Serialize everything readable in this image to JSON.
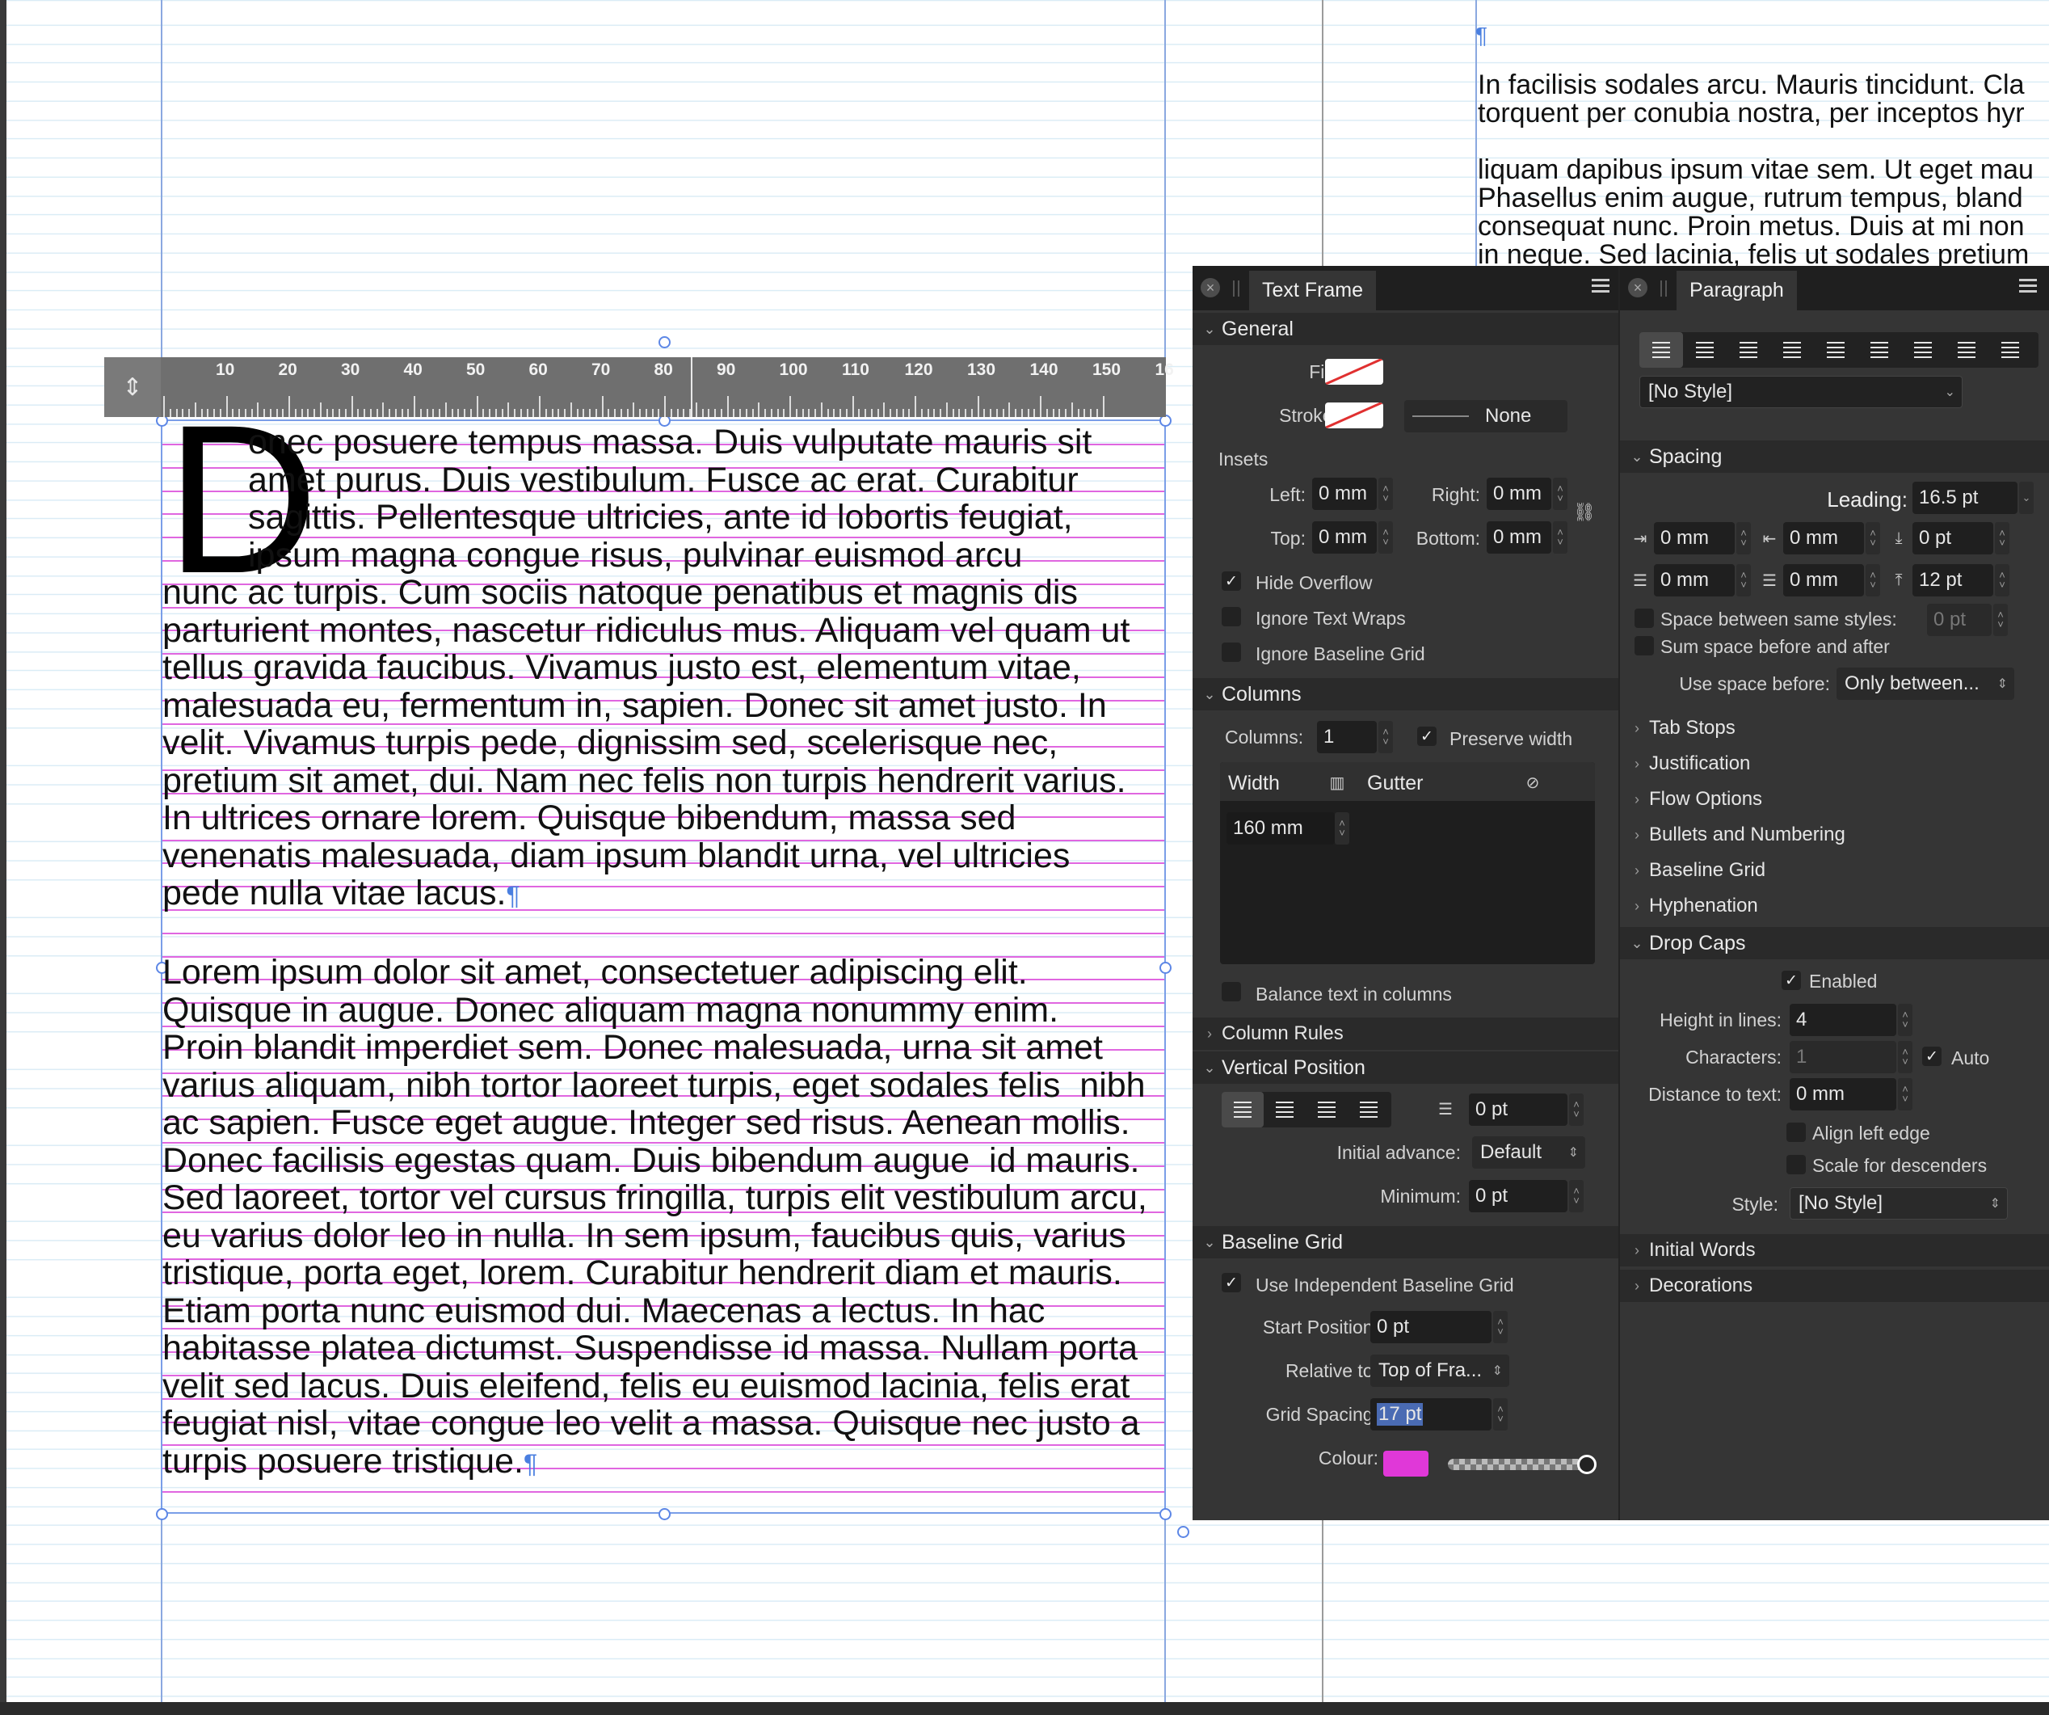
{
  "canvas": {
    "main_text": {
      "drop_cap": "D",
      "para1_lines": [
        "onec posuere tempus massa. Duis vulputate mauris sit",
        "amet purus. Duis vestibulum. Fusce ac erat. Curabitur",
        "sagittis. Pellentesque ultricies, ante id lobortis feugiat,",
        "ipsum magna congue risus, pulvinar euismod arcu",
        "nunc ac turpis. Cum sociis natoque penatibus et magnis dis",
        "parturient montes, nascetur ridiculus mus. Aliquam vel quam ut",
        "tellus gravida faucibus. Vivamus justo est, elementum vitae,",
        "malesuada eu, fermentum in, sapien. Donec sit amet justo. In",
        "velit. Vivamus turpis pede, dignissim sed, scelerisque nec,",
        "pretium sit amet, dui. Nam nec felis non turpis hendrerit varius.",
        "In ultrices ornare lorem. Quisque bibendum, massa sed",
        "venenatis malesuada, diam ipsum blandit urna, vel ultricies",
        "pede nulla vitae lacus."
      ],
      "para2_lines": [
        "Lorem ipsum dolor sit amet, consectetuer adipiscing elit.",
        "Quisque in augue. Donec aliquam magna nonummy enim.",
        "Proin blandit imperdiet sem. Donec malesuada, urna sit amet",
        "varius aliquam, nibh tortor laoreet turpis, eget sodales felis  nibh",
        "ac sapien. Fusce eget augue. Integer sed risus. Aenean mollis.",
        "Donec facilisis egestas quam. Duis bibendum augue  id mauris.",
        "Sed laoreet, tortor vel cursus fringilla, turpis elit vestibulum arcu,",
        "eu varius dolor leo in nulla. In sem ipsum, faucibus quis, varius",
        "tristique, porta eget, lorem. Curabitur hendrerit diam et mauris.",
        "Etiam porta nunc euismod dui. Maecenas a lectus. In hac",
        "habitasse platea dictumst. Suspendisse id massa. Nullam porta",
        "velit sed lacus. Duis eleifend, felis eu euismod lacinia, felis erat",
        "feugiat nisl, vitae congue leo velit a massa. Quisque nec justo a",
        "turpis posuere tristique."
      ],
      "pilcrow": "¶"
    },
    "right_text": "In facilisis sodales arcu. Mauris tincidunt. Cla\ntorquent per conubia nostra, per inceptos hyr\n\nliquam dapibus ipsum vitae sem. Ut eget mau\nPhasellus enim augue, rutrum tempus, bland\nconsequat nunc. Proin metus. Duis at mi non\nin neque. Sed lacinia, felis ut sodales pretium",
    "ruler": {
      "labels": [
        "10",
        "20",
        "30",
        "40",
        "50",
        "60",
        "70",
        "80",
        "90",
        "100",
        "110",
        "120",
        "130",
        "140",
        "150",
        "16"
      ],
      "handle_icon": "⇕"
    }
  },
  "text_frame_panel": {
    "title": "Text Frame",
    "close_icon": "×",
    "general": {
      "header": "General",
      "fill_label": "Fill:",
      "stroke_label": "Stroke:",
      "stroke_none": "None",
      "insets_label": "Insets",
      "left_label": "Left:",
      "left_value": "0 mm",
      "right_label": "Right:",
      "right_value": "0 mm",
      "top_label": "Top:",
      "top_value": "0 mm",
      "bottom_label": "Bottom:",
      "bottom_value": "0 mm",
      "hide_overflow": "Hide Overflow",
      "ignore_text_wraps": "Ignore Text Wraps",
      "ignore_baseline_grid": "Ignore Baseline Grid"
    },
    "columns": {
      "header": "Columns",
      "columns_label": "Columns:",
      "columns_value": "1",
      "preserve_width": "Preserve width",
      "width_header": "Width",
      "gutter_header": "Gutter",
      "width_value": "160 mm",
      "balance": "Balance text in columns"
    },
    "column_rules": "Column Rules",
    "vertical_position": {
      "header": "Vertical Position",
      "offset_value": "0 pt",
      "initial_advance_label": "Initial advance:",
      "initial_advance_value": "Default",
      "minimum_label": "Minimum:",
      "minimum_value": "0 pt"
    },
    "baseline_grid": {
      "header": "Baseline Grid",
      "use_independent": "Use Independent Baseline Grid",
      "start_label": "Start Position:",
      "start_value": "0 pt",
      "relative_label": "Relative to:",
      "relative_value": "Top of Fra...",
      "spacing_label": "Grid Spacing:",
      "spacing_value": "17 pt",
      "colour_label": "Colour:",
      "colour_hex": "#e038d8"
    }
  },
  "paragraph_panel": {
    "title": "Paragraph",
    "style_value": "[No Style]",
    "spacing": {
      "header": "Spacing",
      "leading_label": "Leading:",
      "leading_value": "16.5 pt",
      "left_indent": "0 mm",
      "first_line_indent": "0 mm",
      "space_before": "0 pt",
      "right_indent": "0 mm",
      "last_line_indent": "0 mm",
      "space_after": "12 pt",
      "space_between_label": "Space between same styles:",
      "space_between_value": "0 pt",
      "sum_space": "Sum space before and after",
      "use_space_before_label": "Use space before:",
      "use_space_before_value": "Only between..."
    },
    "collapsed": [
      "Tab Stops",
      "Justification",
      "Flow Options",
      "Bullets and Numbering",
      "Baseline Grid",
      "Hyphenation"
    ],
    "drop_caps": {
      "header": "Drop Caps",
      "enabled": "Enabled",
      "height_label": "Height in lines:",
      "height_value": "4",
      "characters_label": "Characters:",
      "characters_value": "1",
      "auto": "Auto",
      "distance_label": "Distance to text:",
      "distance_value": "0 mm",
      "align_left": "Align left edge",
      "scale_descenders": "Scale for descenders",
      "style_label": "Style:",
      "style_value": "[No Style]"
    },
    "initial_words": "Initial Words",
    "decorations": "Decorations"
  },
  "colors": {
    "baseline_guides": "#cfe6f3",
    "frame_guides": "#7a9ee8",
    "grid_lines": "#e066e0",
    "panel_bg": "#353535"
  }
}
